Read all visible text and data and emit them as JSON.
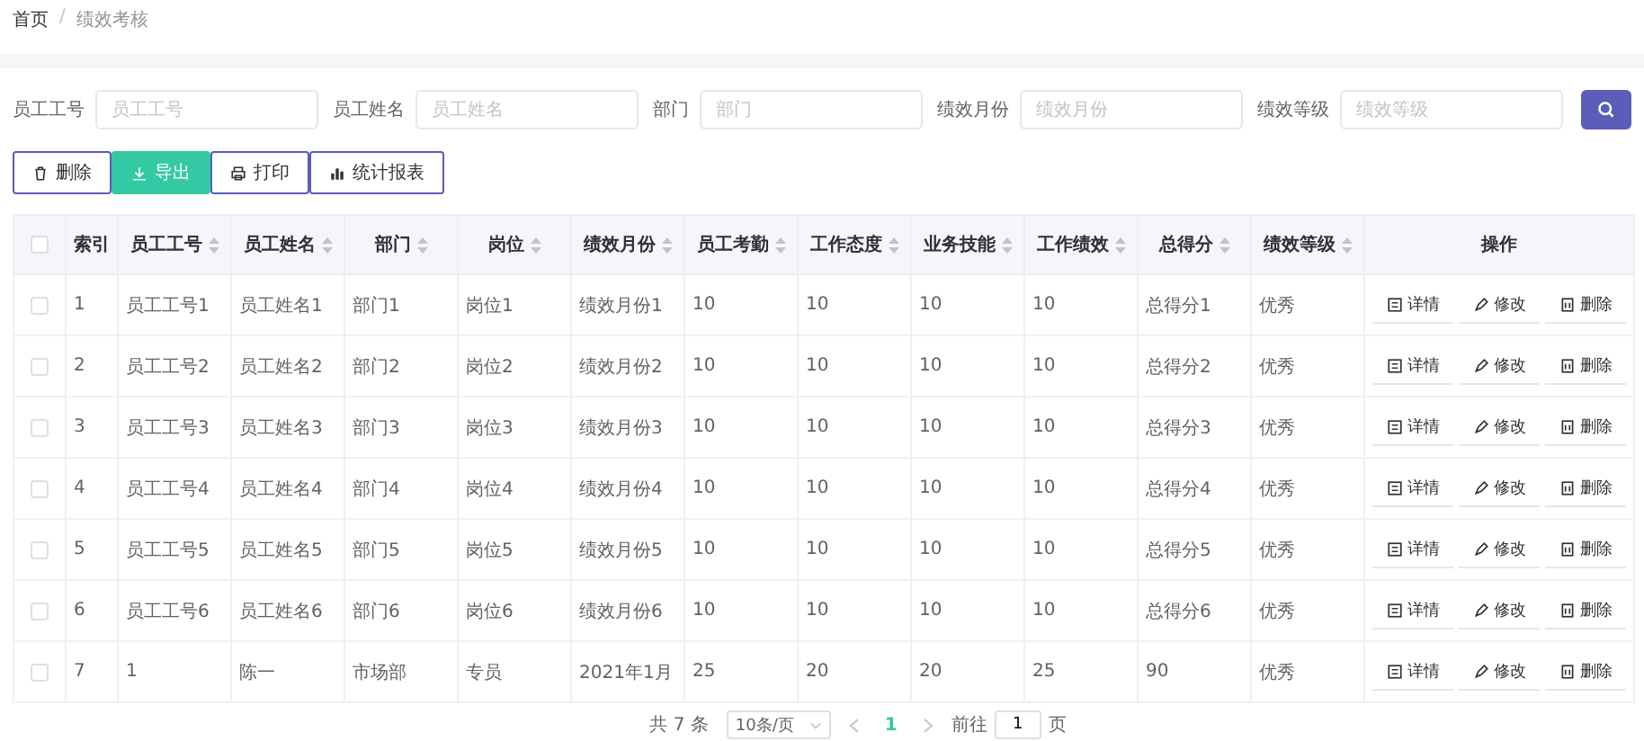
{
  "breadcrumb": {
    "separator": "/",
    "items": [
      {
        "label": "首页"
      },
      {
        "label": "绩效考核"
      }
    ]
  },
  "search": {
    "fields": [
      {
        "label": "员工工号",
        "placeholder": "员工工号"
      },
      {
        "label": "员工姓名",
        "placeholder": "员工姓名"
      },
      {
        "label": "部门",
        "placeholder": "部门"
      },
      {
        "label": "绩效月份",
        "placeholder": "绩效月份"
      },
      {
        "label": "绩效等级",
        "placeholder": "绩效等级"
      }
    ]
  },
  "toolbar": [
    {
      "kind": "delete",
      "label": "删除"
    },
    {
      "kind": "export",
      "label": "导出"
    },
    {
      "kind": "print",
      "label": "打印"
    },
    {
      "kind": "report",
      "label": "统计报表"
    }
  ],
  "table": {
    "select_all_checked": false,
    "columns": [
      {
        "label": "索引",
        "sortable": false
      },
      {
        "label": "员工工号",
        "sortable": true
      },
      {
        "label": "员工姓名",
        "sortable": true
      },
      {
        "label": "部门",
        "sortable": true
      },
      {
        "label": "岗位",
        "sortable": true
      },
      {
        "label": "绩效月份",
        "sortable": true
      },
      {
        "label": "员工考勤",
        "sortable": true
      },
      {
        "label": "工作态度",
        "sortable": true
      },
      {
        "label": "业务技能",
        "sortable": true
      },
      {
        "label": "工作绩效",
        "sortable": true
      },
      {
        "label": "总得分",
        "sortable": true
      },
      {
        "label": "绩效等级",
        "sortable": true
      },
      {
        "label": "操作",
        "sortable": false
      }
    ],
    "rows": [
      {
        "checked": false,
        "cells": [
          "1",
          "员工工号1",
          "员工姓名1",
          "部门1",
          "岗位1",
          "绩效月份1",
          "10",
          "10",
          "10",
          "10",
          "总得分1",
          "优秀"
        ],
        "actions": [
          {
            "kind": "detail",
            "label": "详情"
          },
          {
            "kind": "edit",
            "label": "修改"
          },
          {
            "kind": "delete",
            "label": "删除"
          }
        ]
      },
      {
        "checked": false,
        "cells": [
          "2",
          "员工工号2",
          "员工姓名2",
          "部门2",
          "岗位2",
          "绩效月份2",
          "10",
          "10",
          "10",
          "10",
          "总得分2",
          "优秀"
        ],
        "actions": [
          {
            "kind": "detail",
            "label": "详情"
          },
          {
            "kind": "edit",
            "label": "修改"
          },
          {
            "kind": "delete",
            "label": "删除"
          }
        ]
      },
      {
        "checked": false,
        "cells": [
          "3",
          "员工工号3",
          "员工姓名3",
          "部门3",
          "岗位3",
          "绩效月份3",
          "10",
          "10",
          "10",
          "10",
          "总得分3",
          "优秀"
        ],
        "actions": [
          {
            "kind": "detail",
            "label": "详情"
          },
          {
            "kind": "edit",
            "label": "修改"
          },
          {
            "kind": "delete",
            "label": "删除"
          }
        ]
      },
      {
        "checked": false,
        "cells": [
          "4",
          "员工工号4",
          "员工姓名4",
          "部门4",
          "岗位4",
          "绩效月份4",
          "10",
          "10",
          "10",
          "10",
          "总得分4",
          "优秀"
        ],
        "actions": [
          {
            "kind": "detail",
            "label": "详情"
          },
          {
            "kind": "edit",
            "label": "修改"
          },
          {
            "kind": "delete",
            "label": "删除"
          }
        ]
      },
      {
        "checked": false,
        "cells": [
          "5",
          "员工工号5",
          "员工姓名5",
          "部门5",
          "岗位5",
          "绩效月份5",
          "10",
          "10",
          "10",
          "10",
          "总得分5",
          "优秀"
        ],
        "actions": [
          {
            "kind": "detail",
            "label": "详情"
          },
          {
            "kind": "edit",
            "label": "修改"
          },
          {
            "kind": "delete",
            "label": "删除"
          }
        ]
      },
      {
        "checked": false,
        "cells": [
          "6",
          "员工工号6",
          "员工姓名6",
          "部门6",
          "岗位6",
          "绩效月份6",
          "10",
          "10",
          "10",
          "10",
          "总得分6",
          "优秀"
        ],
        "actions": [
          {
            "kind": "detail",
            "label": "详情"
          },
          {
            "kind": "edit",
            "label": "修改"
          },
          {
            "kind": "delete",
            "label": "删除"
          }
        ]
      },
      {
        "checked": false,
        "cells": [
          "7",
          "1",
          "陈一",
          "市场部",
          "专员",
          "2021年1月",
          "25",
          "20",
          "20",
          "25",
          "90",
          "优秀"
        ],
        "actions": [
          {
            "kind": "detail",
            "label": "详情"
          },
          {
            "kind": "edit",
            "label": "修改"
          },
          {
            "kind": "delete",
            "label": "删除"
          }
        ]
      }
    ]
  },
  "pagination": {
    "total": "共 7 条",
    "page_size": "10条/页",
    "pages": [
      {
        "label": "1",
        "selected": true
      }
    ],
    "goto_label": "前往",
    "goto_value": "1",
    "goto_suffix": "页"
  }
}
